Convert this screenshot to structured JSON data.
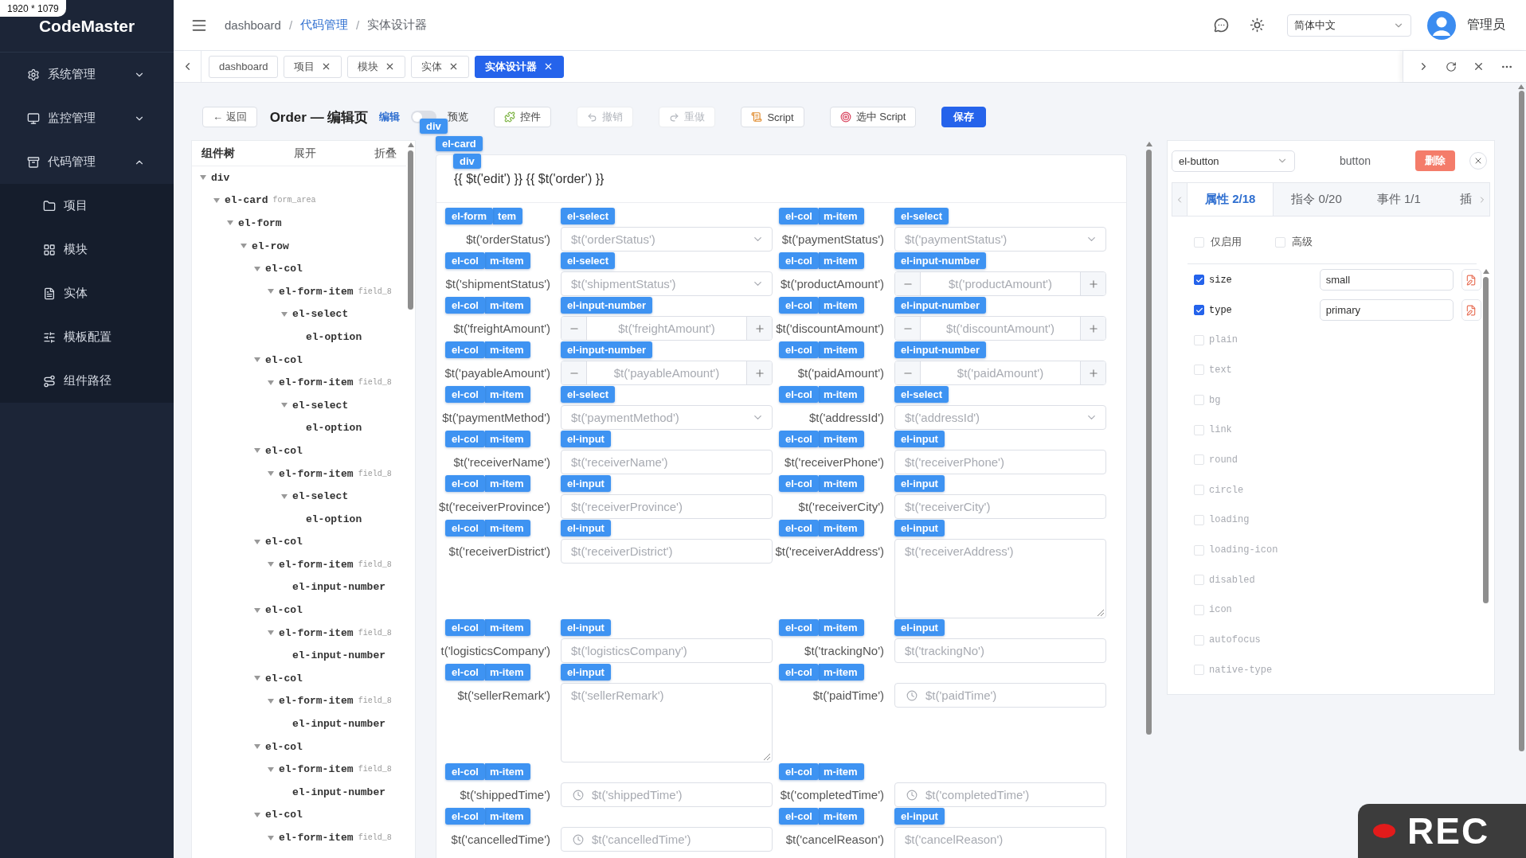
{
  "size_badge": "1920 * 1079",
  "sidebar": {
    "logo": "CodeMaster",
    "items": [
      {
        "label": "系统管理",
        "expanded": false
      },
      {
        "label": "监控管理",
        "expanded": false
      },
      {
        "label": "代码管理",
        "expanded": true,
        "children": [
          {
            "label": "项目"
          },
          {
            "label": "模块"
          },
          {
            "label": "实体"
          },
          {
            "label": "模板配置"
          },
          {
            "label": "组件路径"
          }
        ]
      }
    ]
  },
  "header": {
    "breadcrumb": [
      {
        "kind": "crumb",
        "label": "dashboard"
      },
      {
        "kind": "sep",
        "label": "/"
      },
      {
        "kind": "link",
        "label": "代码管理"
      },
      {
        "kind": "sep",
        "label": "/"
      },
      {
        "kind": "crumb",
        "label": "实体设计器"
      }
    ],
    "language": "简体中文",
    "user": "管理员"
  },
  "tabs": [
    {
      "label": "dashboard",
      "closable": false,
      "selected": false
    },
    {
      "label": "项目",
      "closable": true,
      "selected": false
    },
    {
      "label": "模块",
      "closable": true,
      "selected": false
    },
    {
      "label": "实体",
      "closable": true,
      "selected": false
    },
    {
      "label": "实体设计器",
      "closable": true,
      "selected": true
    }
  ],
  "toolbar": {
    "back": "← 返回",
    "title": "Order — 编辑页",
    "mode_edit": "编辑",
    "preview_on": false,
    "mode_preview": "预览",
    "buttons": [
      {
        "label": "控件",
        "kind": "default",
        "disabled": false
      },
      {
        "label": "撤销",
        "kind": "default",
        "disabled": true
      },
      {
        "label": "重做",
        "kind": "default",
        "disabled": true
      },
      {
        "label": "Script",
        "kind": "default",
        "disabled": false
      },
      {
        "label": "选中 Script",
        "kind": "default",
        "disabled": false
      },
      {
        "label": "保存",
        "kind": "primary",
        "disabled": false
      }
    ]
  },
  "tree": {
    "title": "组件树",
    "expand": "展开",
    "collapse": "折叠",
    "nodes": [
      {
        "tag": "div",
        "expanded": true,
        "children": [
          {
            "tag": "el-card",
            "note": "form_area",
            "expanded": true,
            "children": [
              {
                "tag": "el-form",
                "expanded": true,
                "children": [
                  {
                    "tag": "el-row",
                    "expanded": true,
                    "children": [
                      {
                        "tag": "el-col",
                        "expanded": true,
                        "children": [
                          {
                            "tag": "el-form-item",
                            "note": "field_8",
                            "expanded": true,
                            "children": [
                              {
                                "tag": "el-select",
                                "expanded": true,
                                "children": [
                                  {
                                    "tag": "el-option"
                                  }
                                ]
                              }
                            ]
                          }
                        ]
                      },
                      {
                        "tag": "el-col",
                        "expanded": true,
                        "children": [
                          {
                            "tag": "el-form-item",
                            "note": "field_8",
                            "expanded": true,
                            "children": [
                              {
                                "tag": "el-select",
                                "expanded": true,
                                "children": [
                                  {
                                    "tag": "el-option"
                                  }
                                ]
                              }
                            ]
                          }
                        ]
                      },
                      {
                        "tag": "el-col",
                        "expanded": true,
                        "children": [
                          {
                            "tag": "el-form-item",
                            "note": "field_8",
                            "expanded": true,
                            "children": [
                              {
                                "tag": "el-select",
                                "expanded": true,
                                "children": [
                                  {
                                    "tag": "el-option"
                                  }
                                ]
                              }
                            ]
                          }
                        ]
                      },
                      {
                        "tag": "el-col",
                        "expanded": true,
                        "children": [
                          {
                            "tag": "el-form-item",
                            "note": "field_8",
                            "expanded": true,
                            "children": [
                              {
                                "tag": "el-input-number"
                              }
                            ]
                          }
                        ]
                      },
                      {
                        "tag": "el-col",
                        "expanded": true,
                        "children": [
                          {
                            "tag": "el-form-item",
                            "note": "field_8",
                            "expanded": true,
                            "children": [
                              {
                                "tag": "el-input-number"
                              }
                            ]
                          }
                        ]
                      },
                      {
                        "tag": "el-col",
                        "expanded": true,
                        "children": [
                          {
                            "tag": "el-form-item",
                            "note": "field_8",
                            "expanded": true,
                            "children": [
                              {
                                "tag": "el-input-number"
                              }
                            ]
                          }
                        ]
                      },
                      {
                        "tag": "el-col",
                        "expanded": true,
                        "children": [
                          {
                            "tag": "el-form-item",
                            "note": "field_8",
                            "expanded": true,
                            "children": [
                              {
                                "tag": "el-input-number"
                              }
                            ]
                          }
                        ]
                      },
                      {
                        "tag": "el-col",
                        "expanded": true,
                        "children": [
                          {
                            "tag": "el-form-item",
                            "note": "field_8",
                            "expanded": true
                          }
                        ]
                      }
                    ]
                  }
                ]
              }
            ]
          }
        ]
      }
    ]
  },
  "canvas": {
    "chips": [
      "div",
      "el-card",
      "div"
    ],
    "title": "{{ $t('edit') }} {{ $t('order') }}",
    "rows": [
      [
        {
          "chips": [
            "el-form",
            "tem"
          ],
          "control_tag": "el-select",
          "kind": "select",
          "label": "$t('orderStatus')",
          "placeholder": "$t('orderStatus')"
        },
        {
          "chips": [
            "el-col",
            "m-item"
          ],
          "control_tag": "el-select",
          "kind": "select",
          "label": "$t('paymentStatus')",
          "placeholder": "$t('paymentStatus')"
        }
      ],
      [
        {
          "chips": [
            "el-col",
            "m-item"
          ],
          "control_tag": "el-select",
          "kind": "select",
          "label": "$t('shipmentStatus')",
          "placeholder": "$t('shipmentStatus')"
        },
        {
          "chips": [
            "el-col",
            "m-item"
          ],
          "control_tag": "el-input-number",
          "kind": "number",
          "label": "$t('productAmount')",
          "placeholder": "$t('productAmount')"
        }
      ],
      [
        {
          "chips": [
            "el-col",
            "m-item"
          ],
          "control_tag": "el-input-number",
          "kind": "number",
          "label": "$t('freightAmount')",
          "placeholder": "$t('freightAmount')"
        },
        {
          "chips": [
            "el-col",
            "m-item"
          ],
          "control_tag": "el-input-number",
          "kind": "number",
          "label": "$t('discountAmount')",
          "placeholder": "$t('discountAmount')"
        }
      ],
      [
        {
          "chips": [
            "el-col",
            "m-item"
          ],
          "control_tag": "el-input-number",
          "kind": "number",
          "label": "$t('payableAmount')",
          "placeholder": "$t('payableAmount')"
        },
        {
          "chips": [
            "el-col",
            "m-item"
          ],
          "control_tag": "el-input-number",
          "kind": "number",
          "label": "$t('paidAmount')",
          "placeholder": "$t('paidAmount')"
        }
      ],
      [
        {
          "chips": [
            "el-col",
            "m-item"
          ],
          "control_tag": "el-select",
          "kind": "select",
          "label": "$t('paymentMethod')",
          "placeholder": "$t('paymentMethod')"
        },
        {
          "chips": [
            "el-col",
            "m-item"
          ],
          "control_tag": "el-select",
          "kind": "select",
          "label": "$t('addressId')",
          "placeholder": "$t('addressId')"
        }
      ],
      [
        {
          "chips": [
            "el-col",
            "m-item"
          ],
          "control_tag": "el-input",
          "kind": "input",
          "label": "$t('receiverName')",
          "placeholder": "$t('receiverName')"
        },
        {
          "chips": [
            "el-col",
            "m-item"
          ],
          "control_tag": "el-input",
          "kind": "input",
          "label": "$t('receiverPhone')",
          "placeholder": "$t('receiverPhone')"
        }
      ],
      [
        {
          "chips": [
            "el-col",
            "m-item"
          ],
          "control_tag": "el-input",
          "kind": "input",
          "label": "$t('receiverProvince')",
          "placeholder": "$t('receiverProvince')"
        },
        {
          "chips": [
            "el-col",
            "m-item"
          ],
          "control_tag": "el-input",
          "kind": "input",
          "label": "$t('receiverCity')",
          "placeholder": "$t('receiverCity')"
        }
      ],
      [
        {
          "chips": [
            "el-col",
            "m-item"
          ],
          "control_tag": "el-input",
          "kind": "input",
          "label": "$t('receiverDistrict')",
          "placeholder": "$t('receiverDistrict')"
        },
        {
          "chips": [
            "el-col",
            "m-item"
          ],
          "control_tag": "el-input",
          "kind": "textarea",
          "label": "$t('receiverAddress')",
          "placeholder": "$t('receiverAddress')"
        }
      ],
      [
        {
          "chips": [
            "el-col",
            "m-item"
          ],
          "control_tag": "el-input",
          "kind": "input",
          "label": "t('logisticsCompany')",
          "placeholder": "$t('logisticsCompany')"
        },
        {
          "chips": [
            "el-col",
            "m-item"
          ],
          "control_tag": "el-input",
          "kind": "input",
          "label": "$t('trackingNo')",
          "placeholder": "$t('trackingNo')"
        }
      ],
      [
        {
          "chips": [
            "el-col",
            "m-item"
          ],
          "control_tag": "el-input",
          "kind": "textarea",
          "label": "$t('sellerRemark')",
          "placeholder": "$t('sellerRemark')"
        },
        {
          "chips": [
            "el-col",
            "m-item"
          ],
          "kind": "date",
          "label": "$t('paidTime')",
          "placeholder": "$t('paidTime')"
        }
      ],
      [
        {
          "chips": [
            "el-col",
            "m-item"
          ],
          "kind": "date",
          "label": "$t('shippedTime')",
          "placeholder": "$t('shippedTime')"
        },
        {
          "chips": [
            "el-col",
            "m-item"
          ],
          "kind": "date",
          "label": "$t('completedTime')",
          "placeholder": "$t('completedTime')"
        }
      ],
      [
        {
          "chips": [
            "el-col",
            "m-item"
          ],
          "kind": "date",
          "label": "$t('cancelledTime')",
          "placeholder": "$t('cancelledTime')"
        },
        {
          "chips": [
            "el-col",
            "m-item"
          ],
          "control_tag": "el-input",
          "kind": "textarea",
          "label": "$t('cancelReason')",
          "placeholder": "$t('cancelReason')"
        }
      ]
    ]
  },
  "inspector": {
    "component": "el-button",
    "type_label": "button",
    "delete": "删除",
    "tabs": [
      {
        "label": "属性 2/18",
        "selected": true
      },
      {
        "label": "指令 0/20",
        "selected": false
      },
      {
        "label": "事件 1/1",
        "selected": false
      },
      {
        "label": "插",
        "selected": false
      }
    ],
    "filters": [
      {
        "label": "仅启用",
        "checked": false
      },
      {
        "label": "高级",
        "checked": false
      }
    ],
    "props": [
      {
        "name": "size",
        "checked": true,
        "value": "small"
      },
      {
        "name": "type",
        "checked": true,
        "value": "primary"
      },
      {
        "name": "plain",
        "checked": false
      },
      {
        "name": "text",
        "checked": false
      },
      {
        "name": "bg",
        "checked": false
      },
      {
        "name": "link",
        "checked": false
      },
      {
        "name": "round",
        "checked": false
      },
      {
        "name": "circle",
        "checked": false
      },
      {
        "name": "loading",
        "checked": false
      },
      {
        "name": "loading-icon",
        "checked": false
      },
      {
        "name": "disabled",
        "checked": false
      },
      {
        "name": "icon",
        "checked": false
      },
      {
        "name": "autofocus",
        "checked": false
      },
      {
        "name": "native-type",
        "checked": false
      }
    ]
  },
  "rec": "REC"
}
